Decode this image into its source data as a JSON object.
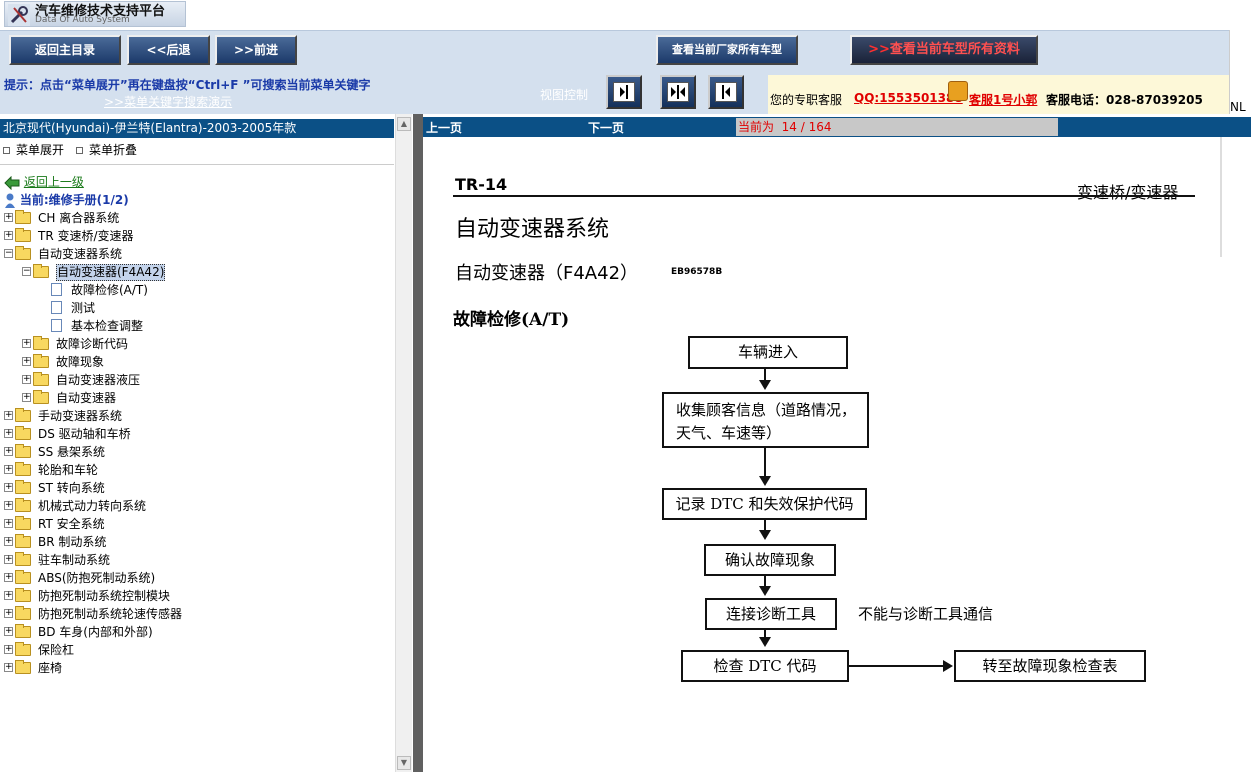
{
  "header": {
    "title": "汽车维修技术支持平台",
    "subtitle": "Data Of Auto System"
  },
  "toolbar": {
    "home": "返回主目录",
    "back": "<<后退",
    "forward": ">>前进",
    "view_manufacturer": "查看当前厂家所有车型",
    "view_all": "查看当前车型所有资料"
  },
  "hint": {
    "text": "提示：点击“菜单展开”再在键盘按“Ctrl+F ”可搜索当前菜单关键字",
    "demo_link": ">>菜单关键字搜索演示",
    "view_control": "视图控制"
  },
  "service": {
    "label": "您的专职客服",
    "qq": "QQ:1553501388",
    "agent": "客服1号小郭",
    "phone": "客服电话：028-87039205",
    "nl": "NL"
  },
  "tree": {
    "title": "北京现代(Hyundai)-伊兰特(Elantra)-2003-2005年款",
    "expand": "菜单展开",
    "collapse": "菜单折叠",
    "back": "返回上一级",
    "current": "当前:维修手册(1/2)",
    "items": [
      {
        "label": "CH 离合器系统",
        "level": 0,
        "type": "folder",
        "state": "+"
      },
      {
        "label": "TR 变速桥/变速器",
        "level": 0,
        "type": "folder",
        "state": "+"
      },
      {
        "label": "自动变速器系统",
        "level": 0,
        "type": "folder",
        "state": "-"
      },
      {
        "label": "自动变速器(F4A42)",
        "level": 1,
        "type": "folder",
        "state": "-",
        "selected": true
      },
      {
        "label": "故障检修(A/T)",
        "level": 2,
        "type": "doc",
        "state": ""
      },
      {
        "label": "测试",
        "level": 2,
        "type": "doc",
        "state": ""
      },
      {
        "label": "基本检查调整",
        "level": 2,
        "type": "doc",
        "state": ""
      },
      {
        "label": "故障诊断代码",
        "level": 1,
        "type": "folder",
        "state": "+"
      },
      {
        "label": "故障现象",
        "level": 1,
        "type": "folder",
        "state": "+"
      },
      {
        "label": "自动变速器液压",
        "level": 1,
        "type": "folder",
        "state": "+"
      },
      {
        "label": "自动变速器",
        "level": 1,
        "type": "folder",
        "state": "+"
      },
      {
        "label": "手动变速器系统",
        "level": 0,
        "type": "folder",
        "state": "+"
      },
      {
        "label": "DS 驱动轴和车桥",
        "level": 0,
        "type": "folder",
        "state": "+"
      },
      {
        "label": "SS 悬架系统",
        "level": 0,
        "type": "folder",
        "state": "+"
      },
      {
        "label": "轮胎和车轮",
        "level": 0,
        "type": "folder",
        "state": "+"
      },
      {
        "label": "ST 转向系统",
        "level": 0,
        "type": "folder",
        "state": "+"
      },
      {
        "label": "机械式动力转向系统",
        "level": 0,
        "type": "folder",
        "state": "+"
      },
      {
        "label": "RT 安全系统",
        "level": 0,
        "type": "folder",
        "state": "+"
      },
      {
        "label": "BR 制动系统",
        "level": 0,
        "type": "folder",
        "state": "+"
      },
      {
        "label": "驻车制动系统",
        "level": 0,
        "type": "folder",
        "state": "+"
      },
      {
        "label": "ABS(防抱死制动系统)",
        "level": 0,
        "type": "folder",
        "state": "+"
      },
      {
        "label": "防抱死制动系统控制模块",
        "level": 0,
        "type": "folder",
        "state": "+"
      },
      {
        "label": "防抱死制动系统轮速传感器",
        "level": 0,
        "type": "folder",
        "state": "+"
      },
      {
        "label": "BD 车身(内部和外部)",
        "level": 0,
        "type": "folder",
        "state": "+"
      },
      {
        "label": "保险杠",
        "level": 0,
        "type": "folder",
        "state": "+"
      },
      {
        "label": "座椅",
        "level": 0,
        "type": "folder",
        "state": "+"
      }
    ]
  },
  "doc_nav": {
    "prev": "上一页",
    "next": "下一页",
    "current_prefix": "当前为",
    "current": "14 / 164"
  },
  "document": {
    "page_code": "TR-14",
    "section": "变速桥/变速器",
    "heading": "自动变速器系统",
    "subheading": "自动变速器（F4A42）",
    "code_id": "EB96578B",
    "topic": "故障检修(A/T)",
    "flow": {
      "step1": "车辆进入",
      "step2_line1": "收集顾客信息（道路情况，",
      "step2_line2": "天气、车速等）",
      "step3": "记录 DTC 和失效保护代码",
      "step4": "确认故障现象",
      "step5": "连接诊断工具",
      "step5_note": "不能与诊断工具通信",
      "step6": "检查 DTC 代码",
      "step7": "转至故障现象检查表"
    }
  }
}
